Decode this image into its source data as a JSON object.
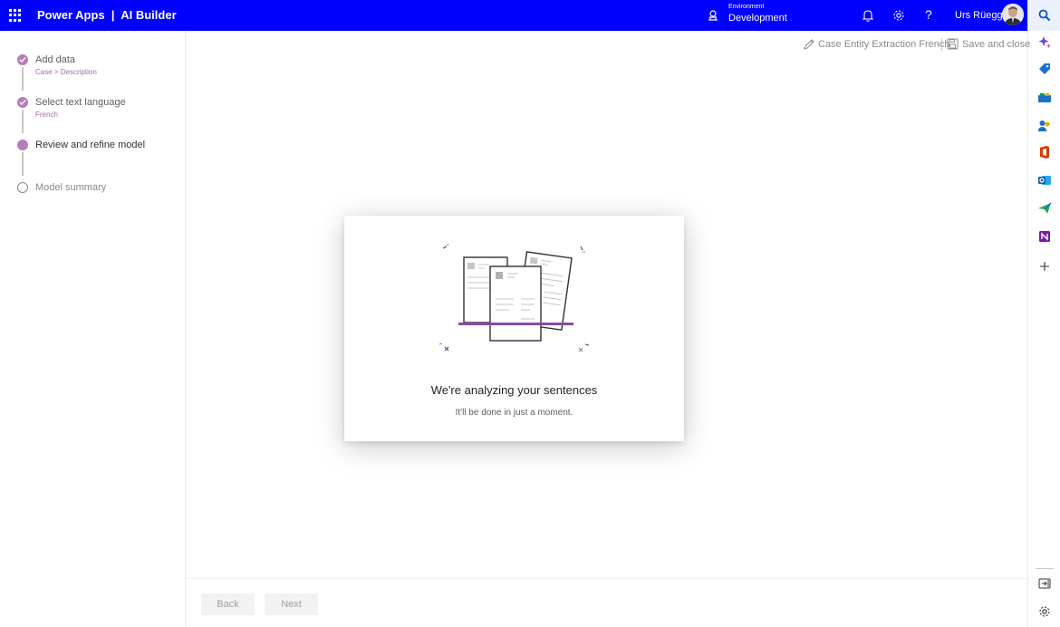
{
  "topbar": {
    "app_title": "Power Apps  |  AI Builder",
    "environment_label": "Environment",
    "environment_value": "Development",
    "help_glyph": "?",
    "user_name": "Urs Rüegg",
    "icons": [
      "waffle-icon",
      "environment-icon",
      "bell-icon",
      "gear-icon",
      "help-icon",
      "avatar"
    ]
  },
  "steps": [
    {
      "title": "Add data",
      "subtitle": "Case > Description",
      "state": "completed"
    },
    {
      "title": "Select text language",
      "subtitle": "French",
      "state": "completed"
    },
    {
      "title": "Review and refine model",
      "subtitle": "",
      "state": "current"
    },
    {
      "title": "Model summary",
      "subtitle": "",
      "state": "pending"
    }
  ],
  "header": {
    "model_name": "Case Entity Extraction French",
    "save_close": "Save and close"
  },
  "card": {
    "title": "We're analyzing your sentences",
    "subtitle": "It'll be done in just a moment."
  },
  "footer": {
    "back_label": "Back",
    "next_label": "Next"
  },
  "right_rail": {
    "icons": [
      "search-icon",
      "copilot-icon",
      "tag-icon",
      "teams-icon",
      "people-icon",
      "office-icon",
      "outlook-icon",
      "send-icon",
      "onenote-icon",
      "add-icon",
      "collapse-icon",
      "settings-icon"
    ]
  },
  "colors": {
    "brand_bar": "#0000ff",
    "step_accent": "#b57eb9",
    "illustration_accent": "#8a4a9e"
  }
}
